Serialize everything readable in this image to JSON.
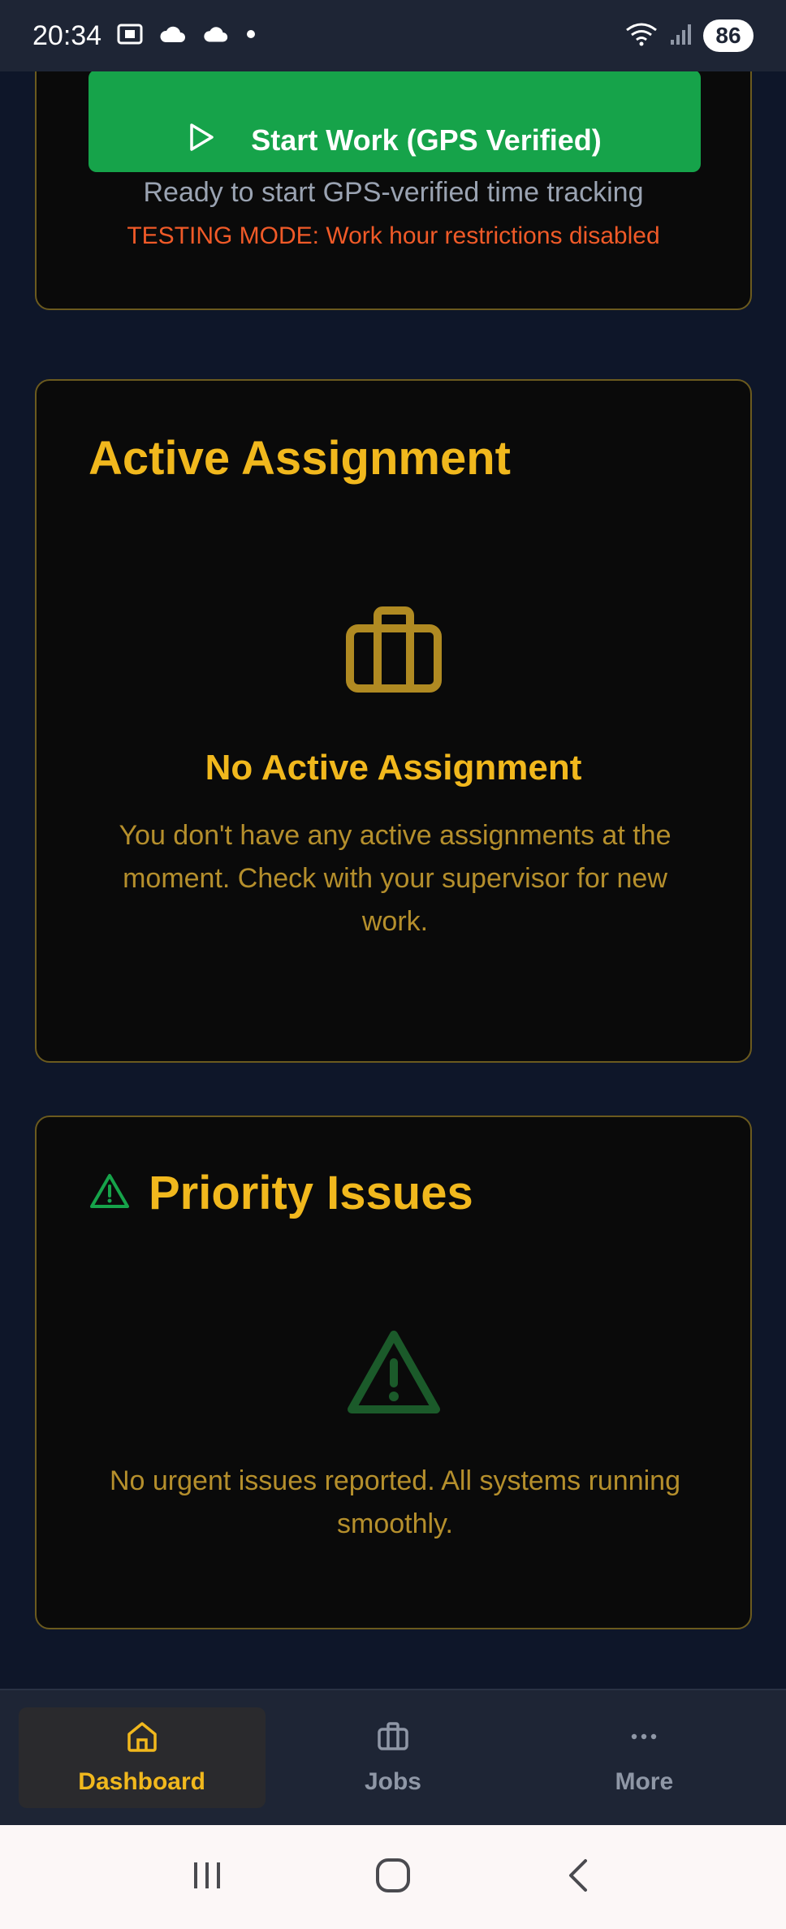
{
  "status_bar": {
    "time": "20:34",
    "battery": "86",
    "icons": [
      "screenshot-icon",
      "cloud-icon",
      "cloud-icon",
      "dot-icon",
      "wifi-icon",
      "signal-icon",
      "battery-icon"
    ]
  },
  "tracking_card": {
    "start_button_label": "Start Work (GPS Verified)",
    "ready_text": "Ready to start GPS-verified time tracking",
    "testing_text": "TESTING MODE: Work hour restrictions disabled"
  },
  "assignment_card": {
    "title": "Active Assignment",
    "empty_heading": "No Active Assignment",
    "empty_text": "You don't have any active assignments at the moment. Check with your supervisor for new work."
  },
  "priority_card": {
    "title": "Priority Issues",
    "empty_text": "No urgent issues reported. All systems running smoothly."
  },
  "bottom_nav": {
    "items": [
      {
        "label": "Dashboard",
        "icon": "home-icon",
        "active": true
      },
      {
        "label": "Jobs",
        "icon": "briefcase-icon",
        "active": false
      },
      {
        "label": "More",
        "icon": "more-icon",
        "active": false
      }
    ]
  },
  "colors": {
    "accent": "#f1b81d",
    "button_green": "#16a34a",
    "warning": "#f05a28",
    "background": "#0e1629"
  }
}
